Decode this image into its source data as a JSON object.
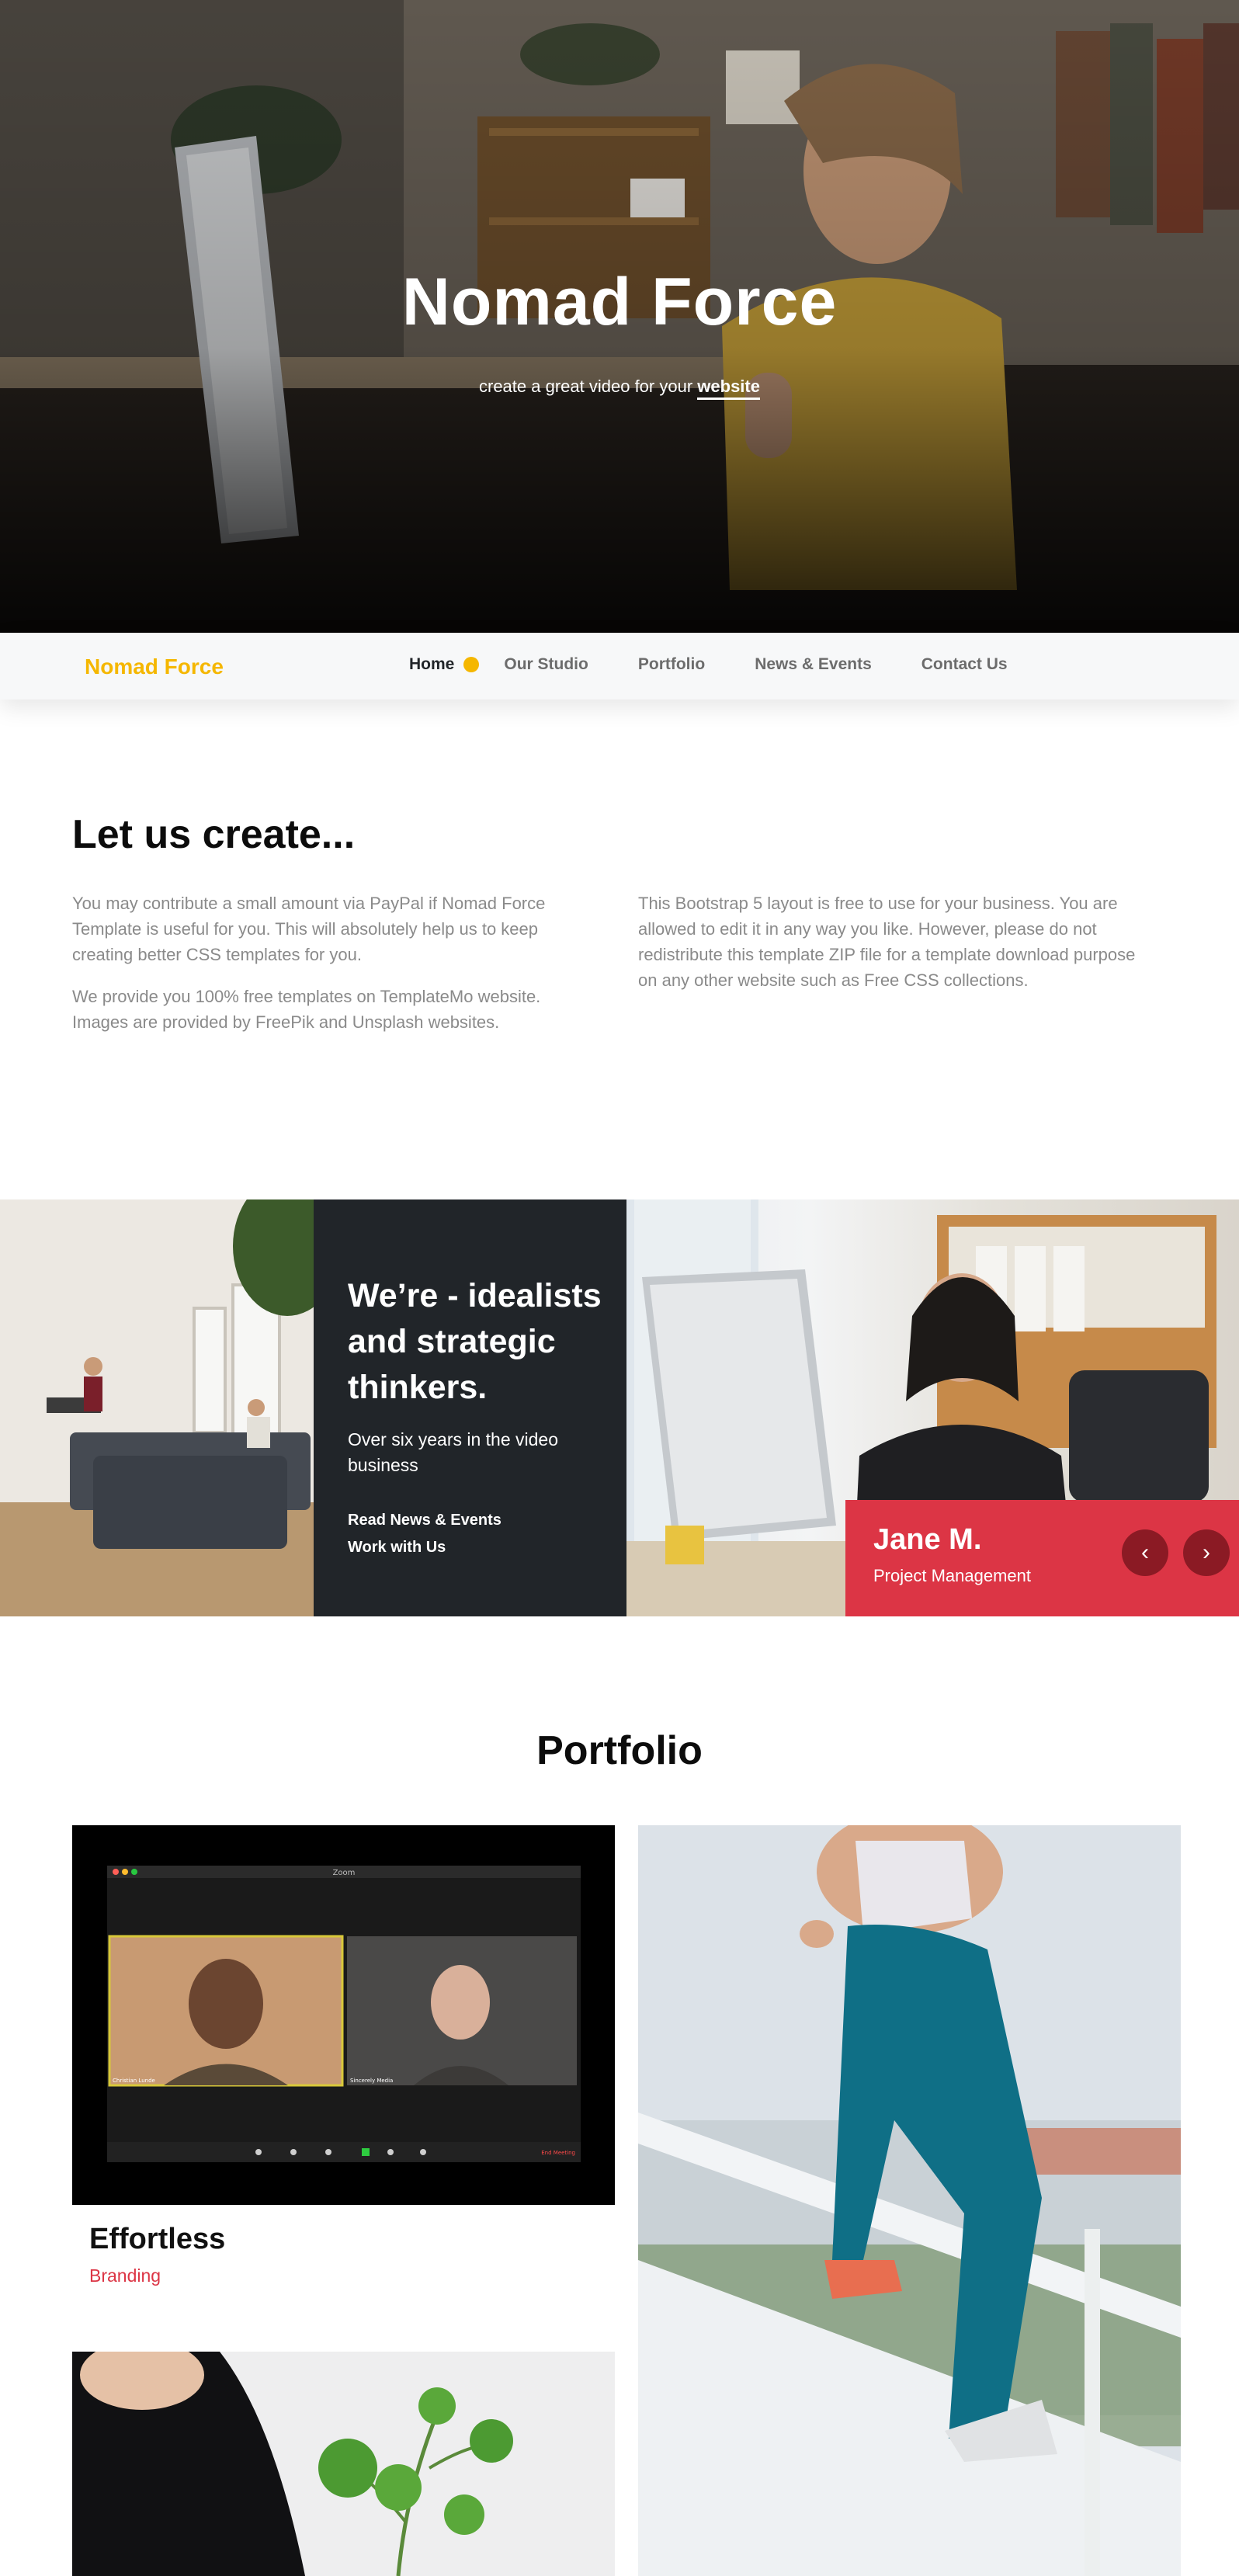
{
  "hero": {
    "title": "Nomad Force",
    "subtitle_prefix": "create a great video for your",
    "subtitle_link": "website"
  },
  "navbar": {
    "brand": "Nomad Force",
    "items": [
      {
        "label": "Home",
        "active": true
      },
      {
        "label": "Our Studio",
        "active": false
      },
      {
        "label": "Portfolio",
        "active": false
      },
      {
        "label": "News & Events",
        "active": false
      },
      {
        "label": "Contact Us",
        "active": false
      }
    ],
    "accent_color": "#f5b700"
  },
  "about": {
    "title": "Let us create...",
    "left_paragraphs": [
      "You may contribute a small amount via PayPal if Nomad Force Template is useful for you. This will absolutely help us to keep creating better CSS templates for you.",
      "We provide you 100% free templates on TemplateMo website. Images are provided by FreePik and Unsplash websites."
    ],
    "right_paragraphs": [
      "This Bootstrap 5 layout is free to use for your business. You are allowed to edit it in any way you like. However, please do not redistribute this template ZIP file for a template download purpose on any other website such as Free CSS collections."
    ]
  },
  "featured": {
    "heading": "We’re - idealists and strategic thinkers.",
    "subtext": "Over six years in the video business",
    "links": [
      "Read News & Events",
      "Work with Us"
    ],
    "person_name": "Jane M.",
    "person_role": "Project Management",
    "card_color": "#dc3545",
    "prev_icon": "chevron-left-icon",
    "next_icon": "chevron-right-icon"
  },
  "portfolio": {
    "title": "Portfolio",
    "items": [
      {
        "title": "Effortless",
        "category": "Branding",
        "screen": {
          "window_title": "Zoom",
          "participants": [
            "Christian Lunde",
            "Sincerely Media"
          ],
          "end_label": "End Meeting"
        }
      }
    ]
  }
}
